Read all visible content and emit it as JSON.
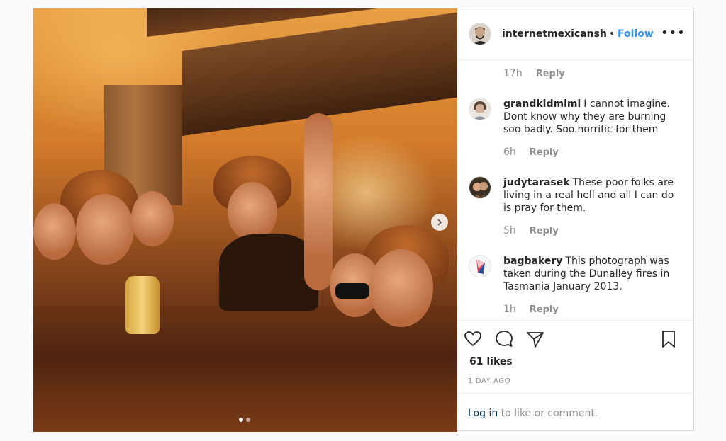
{
  "post": {
    "author": "internetmexicansh",
    "separator": "•",
    "follow_label": "Follow",
    "more_label": "•••",
    "carousel": {
      "total": 2,
      "active": 0
    }
  },
  "comments": {
    "prev_meta": {
      "time": "17h",
      "reply": "Reply"
    },
    "items": [
      {
        "user": "grandkidmimi",
        "text": "I cannot imagine. Dont know why they are burning soo badly. Soo.horrific for them",
        "time": "6h",
        "reply": "Reply"
      },
      {
        "user": "judytarasek",
        "text": "These poor folks are living in a real hell and all I can do is pray for them.",
        "time": "5h",
        "reply": "Reply"
      },
      {
        "user": "bagbakery",
        "text": "This photograph was taken during the Dunalley fires in Tasmania January 2013.",
        "time": "1h",
        "reply": "Reply"
      }
    ]
  },
  "actions": {
    "icons": [
      "heart-icon",
      "comment-icon",
      "share-icon",
      "bookmark-icon"
    ],
    "likes": "61 likes",
    "date": "1 DAY AGO"
  },
  "login": {
    "link": "Log in",
    "rest": " to like or comment."
  },
  "colors": {
    "accent": "#3897f0",
    "link": "#003569",
    "muted": "#8e8e8e",
    "border": "#dbdbdb"
  }
}
